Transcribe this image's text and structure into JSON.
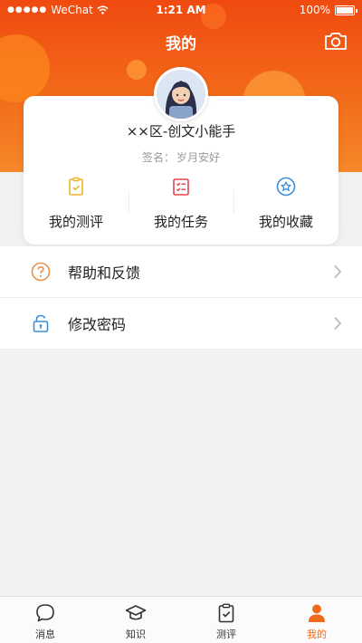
{
  "status_bar": {
    "carrier": "WeChat",
    "time": "1:21 AM",
    "battery": "100%"
  },
  "header": {
    "title": "我的"
  },
  "profile": {
    "name": "××区-创文小能手",
    "sign_label": "签名：",
    "sign_text": "岁月安好"
  },
  "shortcuts": [
    {
      "label": "我的测评",
      "icon": "clipboard-check-icon"
    },
    {
      "label": "我的任务",
      "icon": "task-list-icon"
    },
    {
      "label": "我的收藏",
      "icon": "star-circle-icon"
    }
  ],
  "menu": [
    {
      "label": "帮助和反馈",
      "icon": "question-circle-icon"
    },
    {
      "label": "修改密码",
      "icon": "lock-icon"
    }
  ],
  "tabs": [
    {
      "label": "消息",
      "icon": "chat-bubble-icon",
      "active": false
    },
    {
      "label": "知识",
      "icon": "graduation-cap-icon",
      "active": false
    },
    {
      "label": "测评",
      "icon": "clipboard-icon",
      "active": false
    },
    {
      "label": "我的",
      "icon": "person-icon",
      "active": true
    }
  ],
  "colors": {
    "accent": "#f26a1a",
    "header_top": "#f04a10"
  }
}
